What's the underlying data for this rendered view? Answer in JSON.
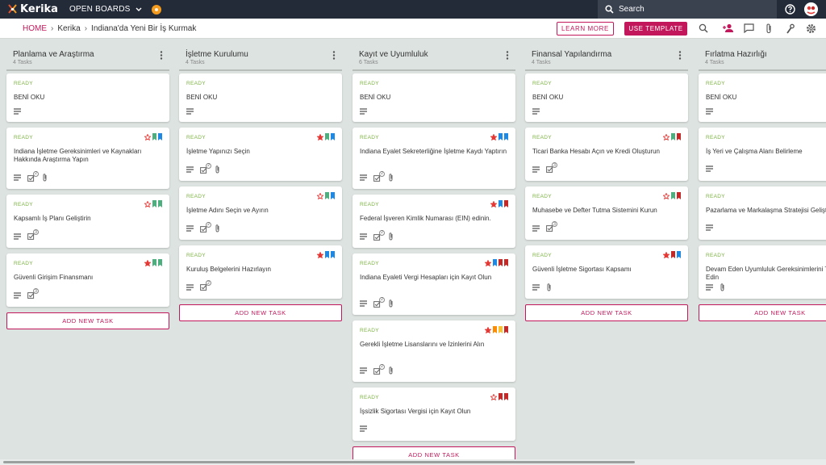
{
  "app": {
    "logo_text": "Kerika",
    "open_boards_label": "OPEN BOARDS",
    "search_placeholder": "Search"
  },
  "breadcrumb": {
    "home": "HOME",
    "items": [
      "Kerika",
      "Indiana'da Yeni Bir İş Kurmak"
    ]
  },
  "toolbar": {
    "learn_more": "LEARN MORE",
    "use_template": "USE TEMPLATE",
    "icons": [
      "search-icon",
      "add-person-icon",
      "chat-icon",
      "attachment-icon",
      "tools-icon",
      "gear-icon"
    ]
  },
  "colors": {
    "accent": "#c2185b",
    "ready": "#7cb342",
    "topbar": "#232a38",
    "star": "#e53935",
    "flag_green": "#4caf7d",
    "flag_blue": "#1e88e5",
    "flag_red": "#c62828",
    "flag_orange": "#fb8c00",
    "flag_yellow": "#fbc02d"
  },
  "add_task_label": "ADD NEW TASK",
  "columns": [
    {
      "title": "Planlama ve Araştırma",
      "count": "4 Tasks",
      "cards": [
        {
          "status": "READY",
          "title": "BENİ OKU",
          "icons": [
            "desc"
          ],
          "flags": []
        },
        {
          "status": "READY",
          "title": "Indiana İşletme Gereksinimleri ve Kaynakları Hakkında Araştırma Yapın",
          "icons": [
            "desc",
            "check",
            "clip"
          ],
          "check_count": "2",
          "star": "outline",
          "flags": [
            "green",
            "blue"
          ]
        },
        {
          "status": "READY",
          "title": "Kapsamlı İş Planı Geliştirin",
          "icons": [
            "desc",
            "check"
          ],
          "check_count": "3",
          "star": "outline",
          "flags": [
            "green",
            "green"
          ]
        },
        {
          "status": "READY",
          "title": "Güvenli Girişim Finansmanı",
          "icons": [
            "desc",
            "check"
          ],
          "check_count": "3",
          "star": "filled",
          "flags": [
            "green",
            "green"
          ]
        }
      ]
    },
    {
      "title": "İşletme Kurulumu",
      "count": "4 Tasks",
      "cards": [
        {
          "status": "READY",
          "title": "BENİ OKU",
          "icons": [
            "desc"
          ],
          "flags": []
        },
        {
          "status": "READY",
          "title": "İşletme Yapınızı Seçin",
          "icons": [
            "desc",
            "check",
            "clip"
          ],
          "check_count": "2",
          "star": "filled",
          "flags": [
            "green",
            "blue"
          ]
        },
        {
          "status": "READY",
          "title": "İşletme Adını Seçin ve Ayırın",
          "icons": [
            "desc",
            "check",
            "clip"
          ],
          "check_count": "2",
          "star": "outline",
          "flags": [
            "green",
            "blue"
          ]
        },
        {
          "status": "READY",
          "title": "Kuruluş Belgelerini Hazırlayın",
          "icons": [
            "desc",
            "check"
          ],
          "check_count": "2",
          "star": "filled",
          "flags": [
            "blue",
            "blue"
          ]
        }
      ]
    },
    {
      "title": "Kayıt ve Uyumluluk",
      "count": "6 Tasks",
      "cards": [
        {
          "status": "READY",
          "title": "BENİ OKU",
          "icons": [
            "desc"
          ],
          "flags": []
        },
        {
          "status": "READY",
          "title": "Indiana Eyalet Sekreterliğine İşletme Kaydı Yaptırın",
          "icons": [
            "desc",
            "check",
            "clip"
          ],
          "check_count": "2",
          "star": "filled",
          "flags": [
            "blue",
            "blue"
          ]
        },
        {
          "status": "READY",
          "title": "Federal İşveren Kimlik Numarası (EIN) edinin.",
          "icons": [
            "desc",
            "check",
            "clip"
          ],
          "check_count": "2",
          "star": "filled",
          "flags": [
            "blue",
            "red"
          ]
        },
        {
          "status": "READY",
          "title": "Indiana Eyaleti Vergi Hesapları için Kayıt Olun",
          "icons": [
            "desc",
            "check",
            "clip"
          ],
          "check_count": "2",
          "star": "filled",
          "flags": [
            "blue",
            "red",
            "red"
          ]
        },
        {
          "status": "READY",
          "title": "Gerekli İşletme Lisanslarını ve İzinlerini Alın",
          "icons": [
            "desc",
            "check",
            "clip"
          ],
          "check_count": "2",
          "star": "filled",
          "flags": [
            "orange",
            "yellow",
            "red"
          ]
        },
        {
          "status": "READY",
          "title": "İşsizlik Sigortası Vergisi için Kayıt Olun",
          "icons": [
            "desc"
          ],
          "star": "outline",
          "flags": [
            "red",
            "red"
          ]
        }
      ]
    },
    {
      "title": "Finansal Yapılandırma",
      "count": "4 Tasks",
      "cards": [
        {
          "status": "READY",
          "title": "BENİ OKU",
          "icons": [
            "desc"
          ],
          "flags": []
        },
        {
          "status": "READY",
          "title": "Ticari Banka Hesabı Açın ve Kredi Oluşturun",
          "icons": [
            "desc",
            "check"
          ],
          "check_count": "3",
          "star": "outline",
          "flags": [
            "green",
            "red"
          ]
        },
        {
          "status": "READY",
          "title": "Muhasebe ve Defter Tutma Sistemini Kurun",
          "icons": [
            "desc",
            "check"
          ],
          "check_count": "3",
          "star": "outline",
          "flags": [
            "green",
            "red"
          ]
        },
        {
          "status": "READY",
          "title": "Güvenli İşletme Sigortası Kapsamı",
          "icons": [
            "desc",
            "clip"
          ],
          "star": "filled",
          "flags": [
            "red",
            "blue"
          ]
        }
      ]
    },
    {
      "title": "Fırlatma Hazırlığı",
      "count": "4 Tasks",
      "cards": [
        {
          "status": "READY",
          "title": "BENİ OKU",
          "icons": [
            "desc"
          ],
          "flags": []
        },
        {
          "status": "READY",
          "title": "İş Yeri ve Çalışma Alanı Belirleme",
          "icons": [
            "desc"
          ],
          "flags": []
        },
        {
          "status": "READY",
          "title": "Pazarlama ve Markalaşma Stratejisi Geliştirin",
          "icons": [
            "desc"
          ],
          "flags": []
        },
        {
          "status": "READY",
          "title": "Devam Eden Uyumluluk Gereksinimlerini Takip Edin",
          "icons": [
            "desc",
            "clip"
          ],
          "flags": []
        }
      ]
    }
  ]
}
